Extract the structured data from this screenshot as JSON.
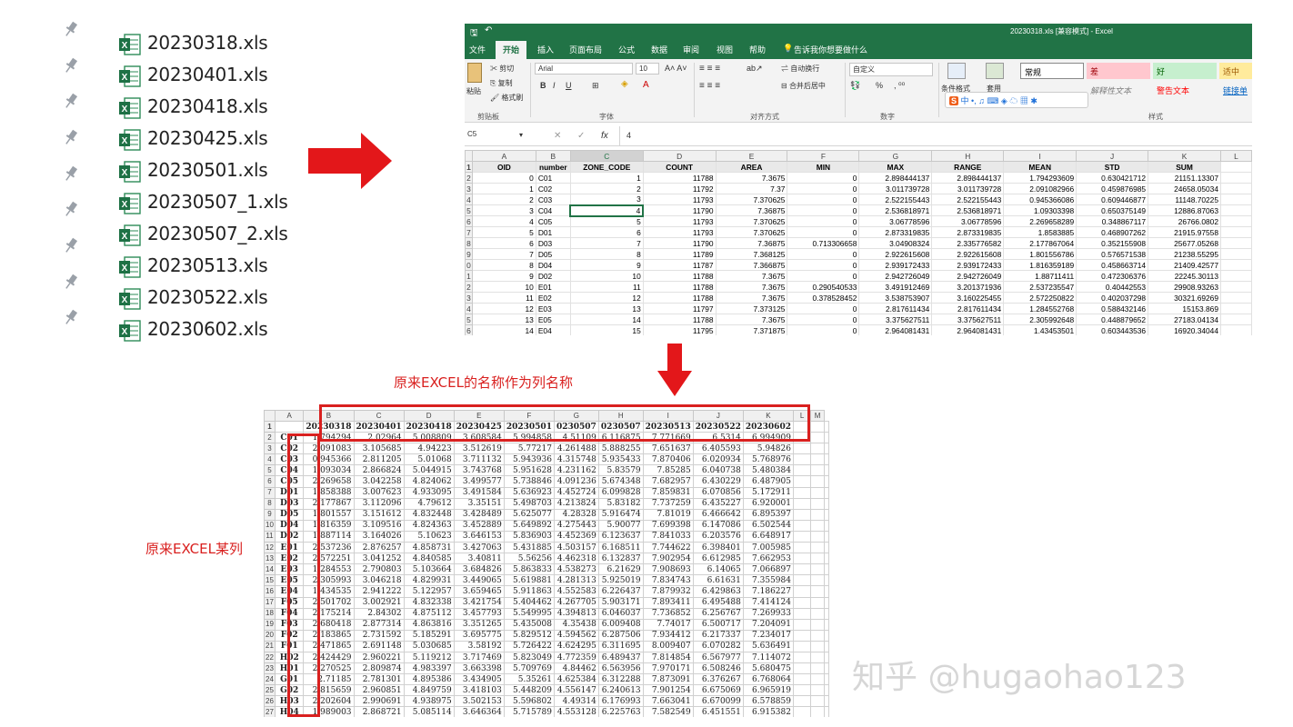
{
  "files": [
    "20230318.xls",
    "20230401.xls",
    "20230418.xls",
    "20230425.xls",
    "20230501.xls",
    "20230507_1.xls",
    "20230507_2.xls",
    "20230513.xls",
    "20230522.xls",
    "20230602.xls"
  ],
  "excel": {
    "title": "20230318.xls  [兼容模式] - Excel",
    "menu_tabs": [
      "文件",
      "开始",
      "插入",
      "页面布局",
      "公式",
      "数据",
      "审阅",
      "视图",
      "帮助"
    ],
    "active_tab": "开始",
    "tell_me": "告诉我你想要做什么",
    "clipboard": {
      "cut": "剪切",
      "copy": "复制",
      "format_painter": "格式刷",
      "paste": "粘贴",
      "group": "剪贴板"
    },
    "font": {
      "name": "Arial",
      "size": "10",
      "group": "字体"
    },
    "alignment": {
      "wrap": "自动换行",
      "merge": "合并后居中",
      "group": "对齐方式"
    },
    "number": {
      "format": "自定义",
      "group": "数字",
      "percent": "%"
    },
    "styles": {
      "cond_format": "条件格式",
      "table_format": "套用",
      "normal": "常规",
      "bad": "差",
      "good": "好",
      "neutral": "适中",
      "explanatory": "解释性文本",
      "warning": "警告文本",
      "link": "链接单",
      "group": "样式"
    },
    "name_box": "C5",
    "formula_value": "4",
    "columns": [
      "",
      "A",
      "B",
      "C",
      "D",
      "E",
      "F",
      "G",
      "H",
      "I",
      "J",
      "K",
      "L"
    ],
    "headers": [
      "OID",
      "number",
      "ZONE_CODE",
      "COUNT",
      "AREA",
      "MIN",
      "MAX",
      "RANGE",
      "MEAN",
      "STD",
      "SUM"
    ],
    "row_numbers": [
      "1",
      "2",
      "3",
      "4",
      "5",
      "6",
      "7",
      "8",
      "9",
      "0",
      "1",
      "2",
      "3",
      "4",
      "5",
      "6"
    ],
    "rows": [
      [
        "0",
        "C01",
        "1",
        "11788",
        "7.3675",
        "0",
        "2.898444137",
        "2.898444137",
        "1.794293609",
        "0.630421712",
        "21151.13307"
      ],
      [
        "1",
        "C02",
        "2",
        "11792",
        "7.37",
        "0",
        "3.011739728",
        "3.011739728",
        "2.091082966",
        "0.459876985",
        "24658.05034"
      ],
      [
        "2",
        "C03",
        "3",
        "11793",
        "7.370625",
        "0",
        "2.522155443",
        "2.522155443",
        "0.945366086",
        "0.609446877",
        "11148.70225"
      ],
      [
        "3",
        "C04",
        "4",
        "11790",
        "7.36875",
        "0",
        "2.536818971",
        "2.536818971",
        "1.09303398",
        "0.650375149",
        "12886.87063"
      ],
      [
        "4",
        "C05",
        "5",
        "11793",
        "7.370625",
        "0",
        "3.06778596",
        "3.06778596",
        "2.269658289",
        "0.348867117",
        "26766.0802"
      ],
      [
        "5",
        "D01",
        "6",
        "11793",
        "7.370625",
        "0",
        "2.873319835",
        "2.873319835",
        "1.8583885",
        "0.468907262",
        "21915.97558"
      ],
      [
        "6",
        "D03",
        "7",
        "11790",
        "7.36875",
        "0.713306658",
        "3.04908324",
        "2.335776582",
        "2.177867064",
        "0.352155908",
        "25677.05268"
      ],
      [
        "7",
        "D05",
        "8",
        "11789",
        "7.368125",
        "0",
        "2.922615608",
        "2.922615608",
        "1.801556786",
        "0.576571538",
        "21238.55295"
      ],
      [
        "8",
        "D04",
        "9",
        "11787",
        "7.366875",
        "0",
        "2.939172433",
        "2.939172433",
        "1.816359189",
        "0.458663714",
        "21409.42577"
      ],
      [
        "9",
        "D02",
        "10",
        "11788",
        "7.3675",
        "0",
        "2.942726049",
        "2.942726049",
        "1.88711411",
        "0.472306376",
        "22245.30113"
      ],
      [
        "10",
        "E01",
        "11",
        "11788",
        "7.3675",
        "0.290540533",
        "3.491912469",
        "3.201371936",
        "2.537235547",
        "0.40442553",
        "29908.93263"
      ],
      [
        "11",
        "E02",
        "12",
        "11788",
        "7.3675",
        "0.378528452",
        "3.538753907",
        "3.160225455",
        "2.572250822",
        "0.402037298",
        "30321.69269"
      ],
      [
        "12",
        "E03",
        "13",
        "11797",
        "7.373125",
        "0",
        "2.817611434",
        "2.817611434",
        "1.284552768",
        "0.588432146",
        "15153.869"
      ],
      [
        "13",
        "E05",
        "14",
        "11788",
        "7.3675",
        "0",
        "3.375627511",
        "3.375627511",
        "2.305992648",
        "0.448879652",
        "27183.04134"
      ],
      [
        "14",
        "E04",
        "15",
        "11795",
        "7.371875",
        "0",
        "2.964081431",
        "2.964081431",
        "1.43453501",
        "0.603443536",
        "16920.34044"
      ]
    ]
  },
  "sheet2": {
    "columns": [
      "",
      "A",
      "B",
      "C",
      "D",
      "E",
      "F",
      "G",
      "H",
      "I",
      "J",
      "K",
      "L",
      "M"
    ],
    "header_row": [
      "",
      "20230318",
      "20230401",
      "20230418",
      "20230425",
      "20230501",
      "0230507",
      "0230507",
      "20230513",
      "20230522",
      "20230602"
    ],
    "rows": [
      [
        "C01",
        "1.794294",
        "2.02964",
        "5.008809",
        "3.608584",
        "5.994858",
        "4.51109",
        "6.116875",
        "7.771669",
        "6.5314",
        "6.994909"
      ],
      [
        "C02",
        "2.091083",
        "3.105685",
        "4.94223",
        "3.512619",
        "5.77217",
        "4.261488",
        "5.888255",
        "7.651637",
        "6.405593",
        "5.94826"
      ],
      [
        "C03",
        "0.945366",
        "2.811205",
        "5.01068",
        "3.711132",
        "5.943936",
        "4.315748",
        "5.935433",
        "7.870406",
        "6.020934",
        "5.768976"
      ],
      [
        "C04",
        "1.093034",
        "2.866824",
        "5.044915",
        "3.743768",
        "5.951628",
        "4.231162",
        "5.83579",
        "7.85285",
        "6.040738",
        "5.480384"
      ],
      [
        "C05",
        "2.269658",
        "3.042258",
        "4.824062",
        "3.499577",
        "5.738846",
        "4.091236",
        "5.674348",
        "7.682957",
        "6.430229",
        "6.487905"
      ],
      [
        "D01",
        "1.858388",
        "3.007623",
        "4.933095",
        "3.491584",
        "5.636923",
        "4.452724",
        "6.099828",
        "7.859831",
        "6.070856",
        "5.172911"
      ],
      [
        "D03",
        "2.177867",
        "3.112096",
        "4.79612",
        "3.35151",
        "5.498703",
        "4.213824",
        "5.83182",
        "7.737259",
        "6.435227",
        "6.920001"
      ],
      [
        "D05",
        "1.801557",
        "3.151612",
        "4.832448",
        "3.428489",
        "5.625077",
        "4.28328",
        "5.916474",
        "7.81019",
        "6.466642",
        "6.895397"
      ],
      [
        "D04",
        "1.816359",
        "3.109516",
        "4.824363",
        "3.452889",
        "5.649892",
        "4.275443",
        "5.90077",
        "7.699398",
        "6.147086",
        "6.502544"
      ],
      [
        "D02",
        "1.887114",
        "3.164026",
        "5.10623",
        "3.646153",
        "5.836903",
        "4.452369",
        "6.123637",
        "7.841033",
        "6.203576",
        "6.648917"
      ],
      [
        "E01",
        "2.537236",
        "2.876257",
        "4.858731",
        "3.427063",
        "5.431885",
        "4.503157",
        "6.168511",
        "7.744622",
        "6.398401",
        "7.005985"
      ],
      [
        "E02",
        "2.572251",
        "3.041252",
        "4.840585",
        "3.40811",
        "5.56256",
        "4.462318",
        "6.132837",
        "7.902954",
        "6.612985",
        "7.662953"
      ],
      [
        "E03",
        "1.284553",
        "2.790803",
        "5.103664",
        "3.684826",
        "5.863833",
        "4.538273",
        "6.21629",
        "7.908693",
        "6.14065",
        "7.066897"
      ],
      [
        "E05",
        "2.305993",
        "3.046218",
        "4.829931",
        "3.449065",
        "5.619881",
        "4.281313",
        "5.925019",
        "7.834743",
        "6.61631",
        "7.355984"
      ],
      [
        "E04",
        "1.434535",
        "2.941222",
        "5.122957",
        "3.659465",
        "5.911863",
        "4.552583",
        "6.226437",
        "7.879932",
        "6.429863",
        "7.186227"
      ],
      [
        "F05",
        "2.501702",
        "3.002921",
        "4.832338",
        "3.421754",
        "5.404462",
        "4.267705",
        "5.903171",
        "7.893411",
        "6.495488",
        "7.414124"
      ],
      [
        "F04",
        "2.175214",
        "2.84302",
        "4.875112",
        "3.457793",
        "5.549995",
        "4.394813",
        "6.046037",
        "7.736852",
        "6.256767",
        "7.269933"
      ],
      [
        "F03",
        "2.680418",
        "2.877314",
        "4.863816",
        "3.351265",
        "5.435008",
        "4.35438",
        "6.009408",
        "7.74017",
        "6.500717",
        "7.204091"
      ],
      [
        "F02",
        "2.183865",
        "2.731592",
        "5.185291",
        "3.695775",
        "5.829512",
        "4.594562",
        "6.287506",
        "7.934412",
        "6.217337",
        "7.234017"
      ],
      [
        "F01",
        "2.471865",
        "2.691148",
        "5.030685",
        "3.58192",
        "5.726422",
        "4.624295",
        "6.311695",
        "8.009407",
        "6.070282",
        "5.636491"
      ],
      [
        "H02",
        "2.424429",
        "2.960221",
        "5.119212",
        "3.717469",
        "5.823049",
        "4.772359",
        "6.489437",
        "7.814854",
        "6.567977",
        "7.114072"
      ],
      [
        "H01",
        "2.270525",
        "2.809874",
        "4.983397",
        "3.663398",
        "5.709769",
        "4.84462",
        "6.563956",
        "7.970171",
        "6.508246",
        "5.680475"
      ],
      [
        "G01",
        "2.71185",
        "2.781301",
        "4.895386",
        "3.434905",
        "5.35261",
        "4.625384",
        "6.312288",
        "7.873091",
        "6.376267",
        "6.768064"
      ],
      [
        "G02",
        "2.815659",
        "2.960851",
        "4.849759",
        "3.418103",
        "5.448209",
        "4.556147",
        "6.240613",
        "7.901254",
        "6.675069",
        "6.965919"
      ],
      [
        "H03",
        "2.202604",
        "2.990691",
        "4.938975",
        "3.502153",
        "5.596802",
        "4.49314",
        "6.176993",
        "7.663041",
        "6.670099",
        "6.578859"
      ],
      [
        "H04",
        "1.989003",
        "2.868721",
        "5.085114",
        "3.646364",
        "5.715789",
        "4.553128",
        "6.225763",
        "7.582549",
        "6.451551",
        "6.915382"
      ]
    ]
  },
  "annotations": {
    "top": "原来EXCEL的名称作为列名称",
    "left": "原来EXCEL某列"
  },
  "watermark": "知乎 @hugaohao123"
}
